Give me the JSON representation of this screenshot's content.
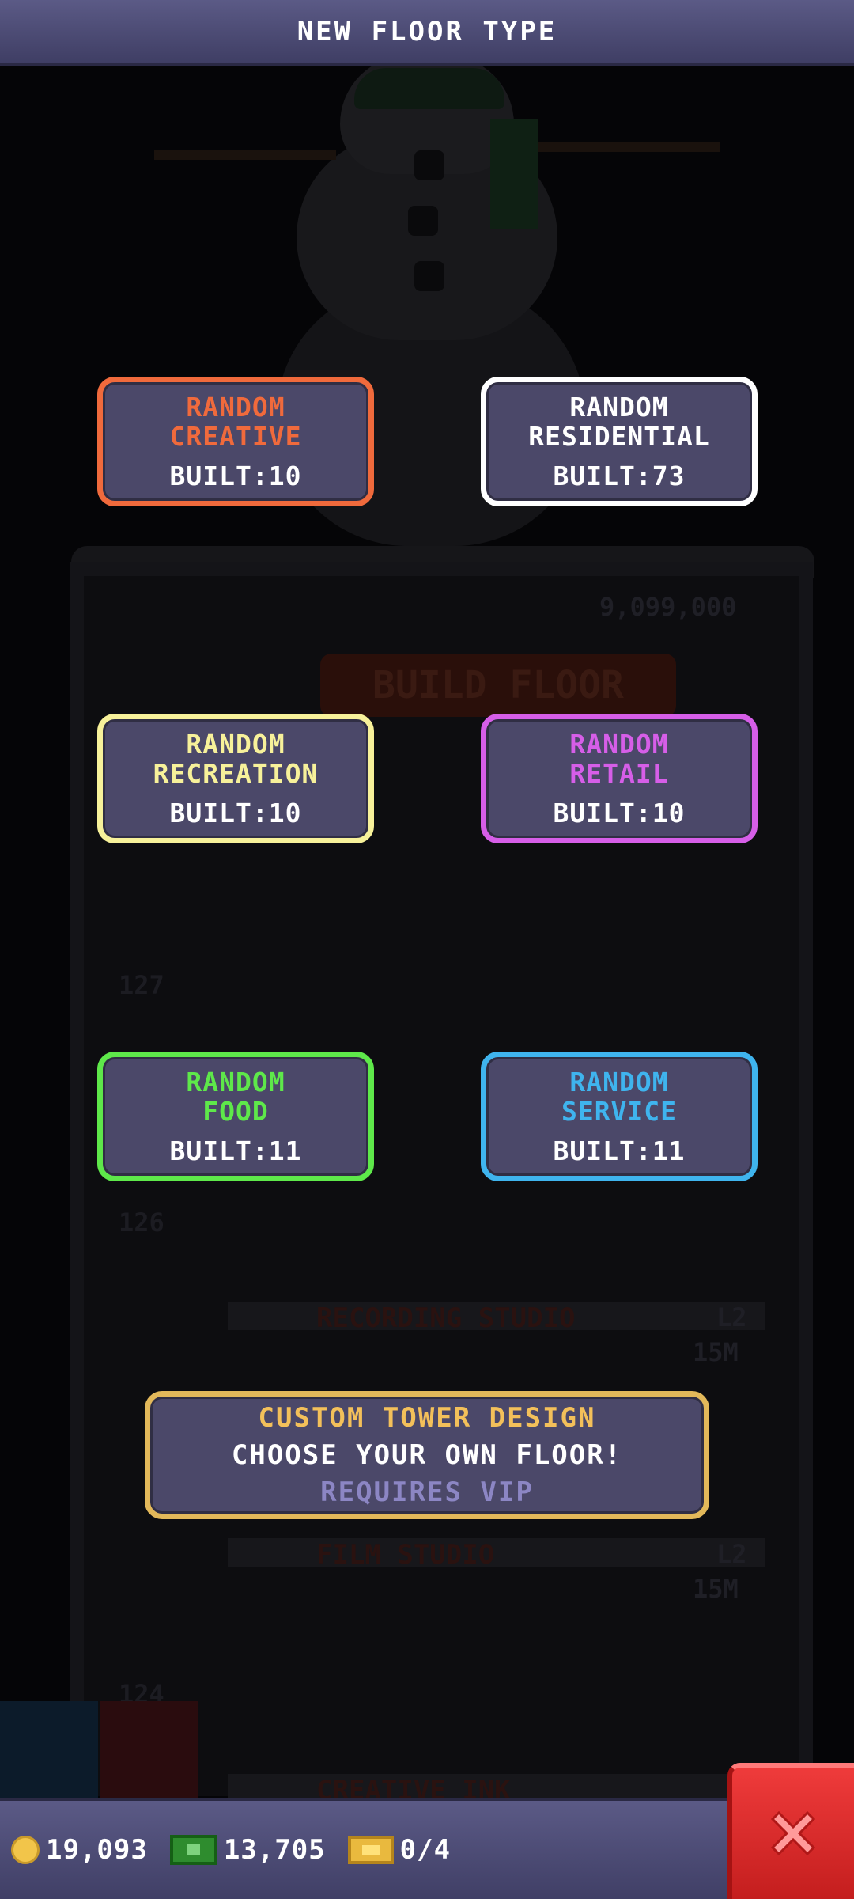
{
  "title": "NEW FLOOR TYPE",
  "categories": [
    {
      "name": "RANDOM\nCREATIVE",
      "built": "BUILT:10",
      "color": "#f06a3c"
    },
    {
      "name": "RANDOM\nRESIDENTIAL",
      "built": "BUILT:73",
      "color": "#ffffff"
    },
    {
      "name": "RANDOM\nRECREATION",
      "built": "BUILT:10",
      "color": "#f7f19a"
    },
    {
      "name": "RANDOM\nRETAIL",
      "built": "BUILT:10",
      "color": "#d65ee8"
    },
    {
      "name": "RANDOM\nFOOD",
      "built": "BUILT:11",
      "color": "#5ee84a"
    },
    {
      "name": "RANDOM\nSERVICE",
      "built": "BUILT:11",
      "color": "#3fb4ee"
    }
  ],
  "custom": {
    "line1": "CUSTOM TOWER DESIGN",
    "line2": "CHOOSE YOUR OWN FLOOR!",
    "line3": "REQUIRES VIP",
    "border_color": "#e2b85a"
  },
  "status": {
    "coins": "19,093",
    "bux": "13,705",
    "tickets": "0/4",
    "coin_icon": "coin-icon",
    "bux_icon": "bux-icon",
    "ticket_icon": "ticket-icon"
  },
  "close": {
    "icon": "close-icon",
    "color": "#e02a2a"
  },
  "background": {
    "price": "9,099,000",
    "build_floor": "BUILD FLOOR",
    "floor_127": "127",
    "floor_126": "126",
    "floor_124": "124",
    "recording_studio": "RECORDING STUDIO",
    "film_studio": "FILM STUDIO",
    "creative_ink": "CREATIVE INK",
    "level_a": "L2",
    "level_b": "L2",
    "cost_a": "15M",
    "cost_b": "15M"
  }
}
